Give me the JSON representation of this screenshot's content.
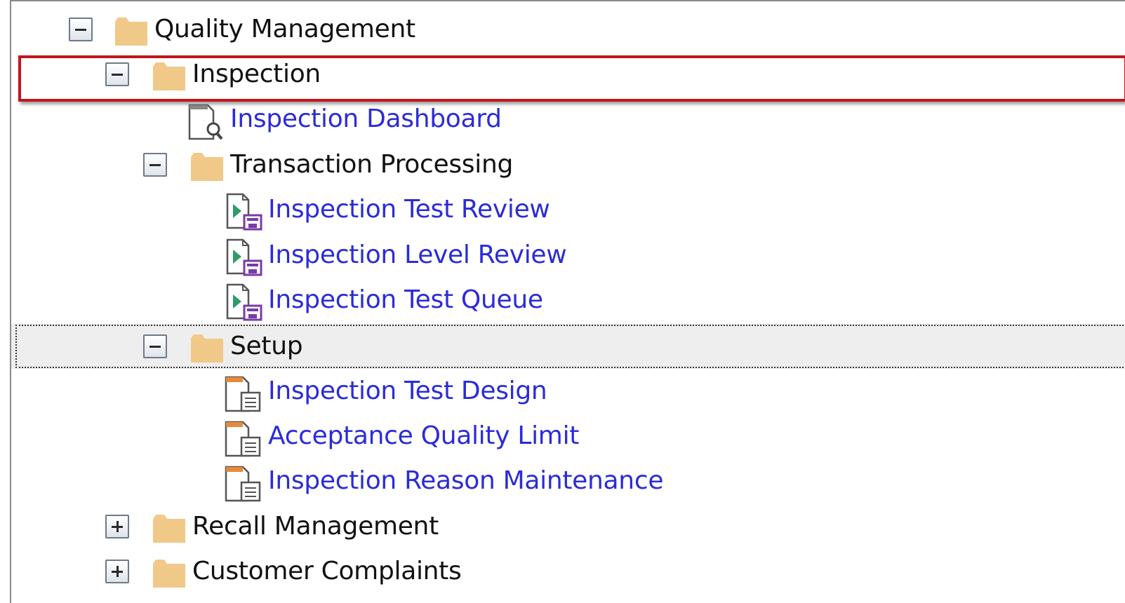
{
  "tree": {
    "quality_management": {
      "label": "Quality Management",
      "expanded": true
    },
    "inspection": {
      "label": "Inspection",
      "expanded": true,
      "highlighted": true
    },
    "inspection_dashboard": {
      "label": "Inspection Dashboard"
    },
    "transaction_processing": {
      "label": "Transaction Processing",
      "expanded": true
    },
    "inspection_test_review": {
      "label": "Inspection Test Review"
    },
    "inspection_level_review": {
      "label": "Inspection Level Review"
    },
    "inspection_test_queue": {
      "label": "Inspection Test Queue"
    },
    "setup": {
      "label": "Setup",
      "expanded": true,
      "selected": true
    },
    "inspection_test_design": {
      "label": "Inspection Test Design"
    },
    "acceptance_quality_limit": {
      "label": "Acceptance Quality Limit"
    },
    "inspection_reason_maintenance": {
      "label": "Inspection Reason Maintenance"
    },
    "recall_management": {
      "label": "Recall Management",
      "expanded": false
    },
    "customer_complaints": {
      "label": "Customer Complaints",
      "expanded": false
    }
  },
  "icons": {
    "folder": "folder-icon",
    "dashboard": "dashboard-icon",
    "transaction": "transaction-form-icon",
    "setup_form": "setup-form-icon",
    "expand": "expand-icon",
    "collapse": "collapse-icon"
  },
  "colors": {
    "link": "#2b2bd9",
    "folder": "#f2c98a",
    "highlight_border": "#c0161c",
    "selection_bg": "#eeeeee"
  }
}
